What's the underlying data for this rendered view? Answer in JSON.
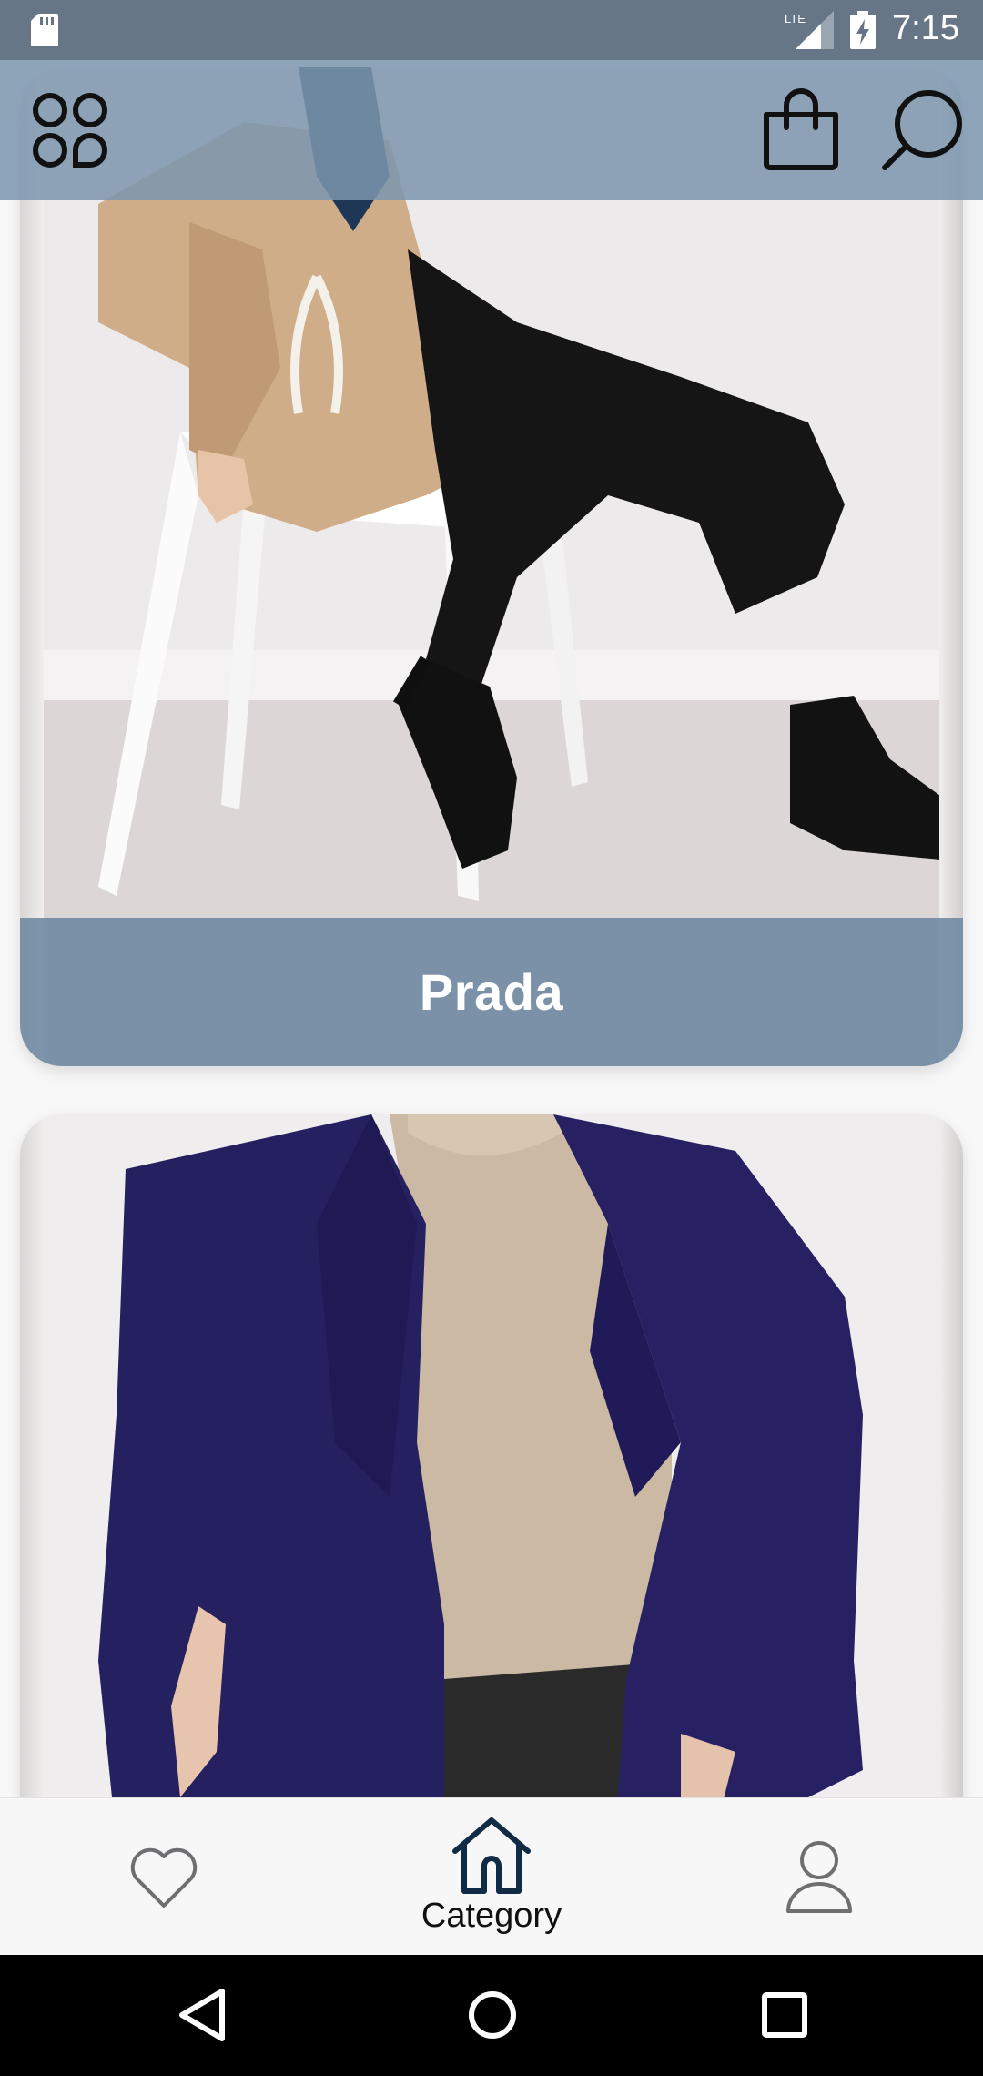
{
  "status_bar": {
    "time": "7:15",
    "network": "LTE",
    "icons": [
      "sd-card-icon",
      "lte-signal-icon",
      "battery-charging-icon"
    ]
  },
  "app_bar": {
    "icons": [
      "menu-grid-icon",
      "shopping-bag-icon",
      "search-icon"
    ],
    "background": "#7d96af"
  },
  "brands": [
    {
      "name": "Prada",
      "image": "woman in beige jacket and black trousers sitting on white chair"
    },
    {
      "name": "",
      "image": "woman in navy wool coat over beige knit sweater"
    }
  ],
  "bottom_nav": {
    "items": [
      {
        "icon": "heart-icon",
        "label": ""
      },
      {
        "icon": "home-icon",
        "label": "Category"
      },
      {
        "icon": "profile-icon",
        "label": ""
      }
    ],
    "active": "Category",
    "active_color": "#0f2b46"
  },
  "system_nav": [
    "back-icon",
    "home-circle-icon",
    "recent-apps-icon"
  ]
}
